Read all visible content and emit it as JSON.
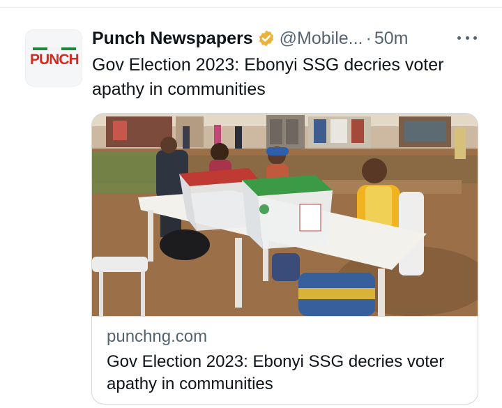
{
  "tweet": {
    "author_name": "Punch Newspapers",
    "handle": "@Mobile...",
    "separator": "·",
    "time_ago": "50m",
    "text": "Gov Election 2023: Ebonyi SSG decries voter apathy in communities",
    "avatar_logo_text": "PUNCH",
    "verified_icon": "verified-badge-icon",
    "more_icon": "more-horizontal-icon"
  },
  "card": {
    "domain": "punchng.com",
    "title": "Gov Election 2023: Ebonyi SSG decries voter apathy in communities",
    "image_description": "photo-of-polling-unit-with-ballot-boxes"
  },
  "colors": {
    "brand_red": "#d62b1e",
    "gold_badge": "#e8b33b",
    "secondary_text": "#536471",
    "border": "#cfd9de"
  }
}
